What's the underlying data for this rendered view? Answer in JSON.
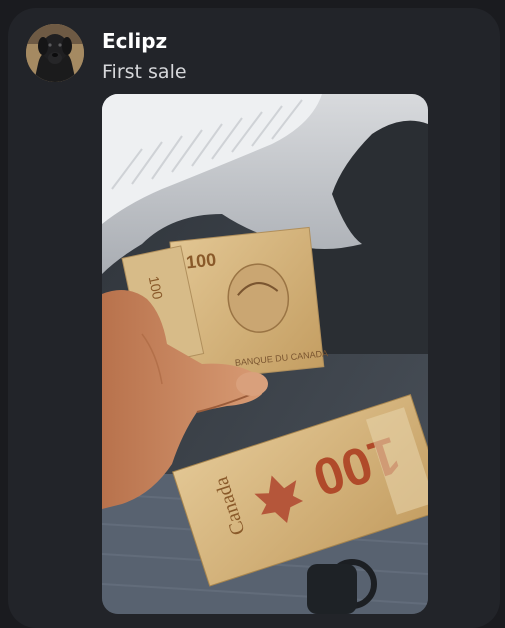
{
  "post": {
    "author": "Eclipz",
    "message": "First sale"
  },
  "avatar": {
    "icon": "dog-avatar-icon"
  },
  "photo": {
    "subject": "hand-holding-canadian-100-dollar-bills-in-bag",
    "banknote_text": [
      "100",
      "Canada",
      "BANQUE DU CANADA"
    ],
    "colors": {
      "banknote": "#d2b27a",
      "fabric": "#c9ccd0",
      "bag": "#3d434b",
      "skin": "#c98a62"
    }
  },
  "theme": {
    "background": "#1a1b1f",
    "card": "#222429",
    "text_primary": "#ffffff",
    "text_secondary": "#d6d7da"
  }
}
